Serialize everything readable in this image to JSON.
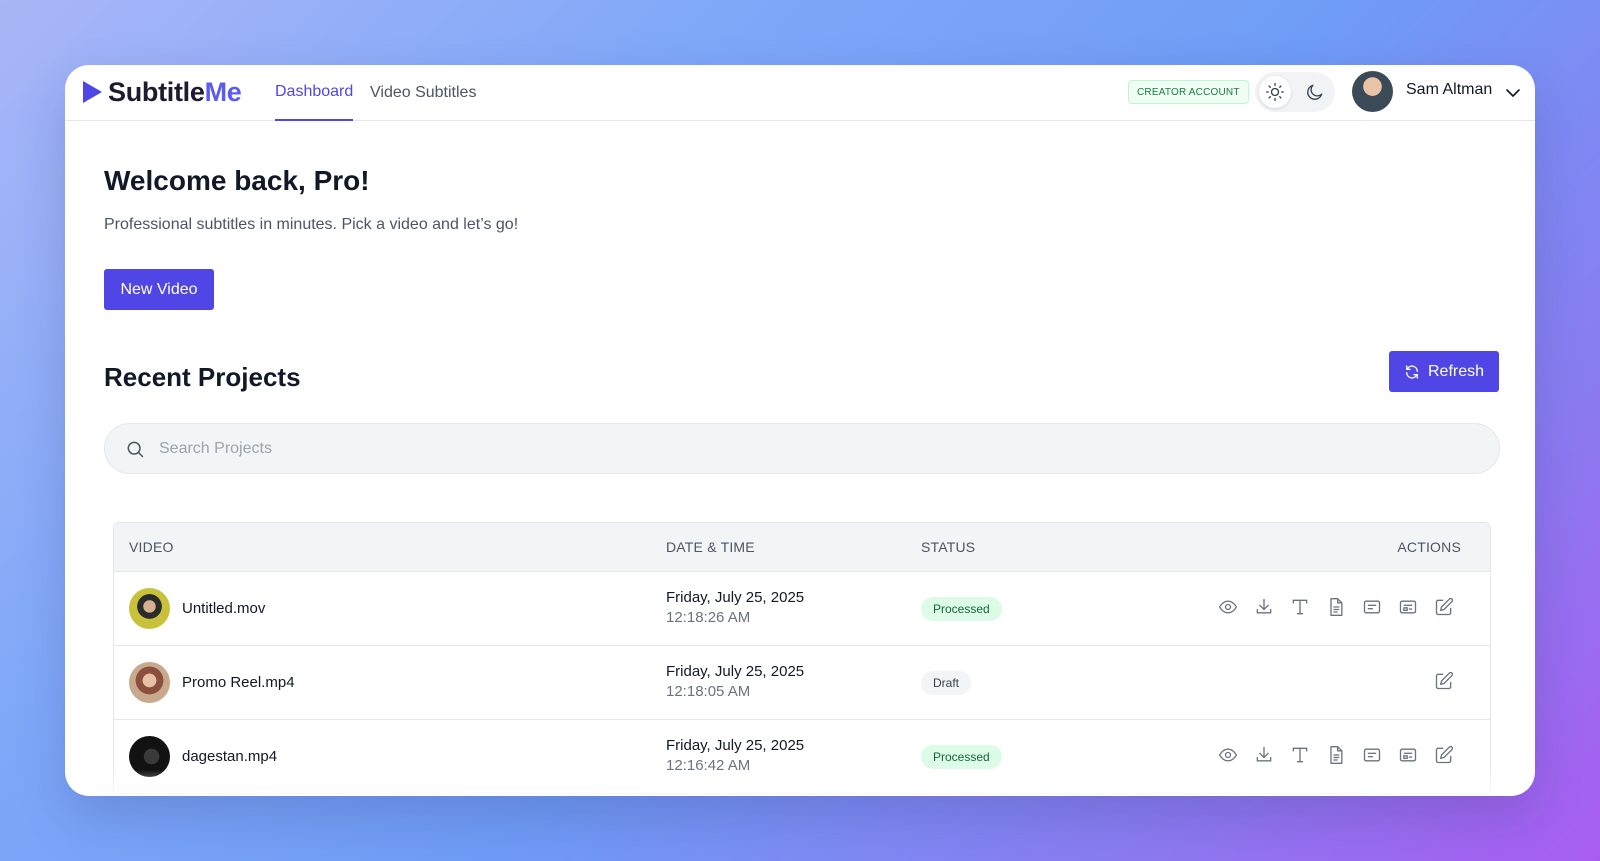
{
  "app": {
    "logo_main": "Subtitle",
    "logo_accent": "Me",
    "accent_color": "#4f46e5"
  },
  "nav": {
    "tabs": [
      {
        "label": "Dashboard",
        "active": true
      },
      {
        "label": "Video Subtitles",
        "active": false
      }
    ]
  },
  "header": {
    "account_badge": "CREATOR ACCOUNT",
    "theme_options": [
      "sun-icon",
      "moon-icon"
    ],
    "theme_selected": "light",
    "user_name": "Sam Altman"
  },
  "main": {
    "welcome": "Welcome back, Pro!",
    "subtitle": "Professional subtitles in minutes. Pick a video and let’s go!",
    "new_video_label": "New Video",
    "section_title": "Recent Projects",
    "refresh_label": "Refresh",
    "search_placeholder": "Search Projects"
  },
  "table": {
    "columns": [
      "VIDEO",
      "DATE & TIME",
      "STATUS",
      "ACTIONS"
    ],
    "rows": [
      {
        "name": "Untitled.mov",
        "date": "Friday, July 25, 2025",
        "time": "12:18:26 AM",
        "status": "Processed",
        "actions": [
          "eye-icon",
          "download-icon",
          "text-icon",
          "document-icon",
          "subtitle-icon",
          "caption-icon",
          "edit-icon"
        ]
      },
      {
        "name": "Promo Reel.mp4",
        "date": "Friday, July 25, 2025",
        "time": "12:18:05 AM",
        "status": "Draft",
        "actions": [
          "edit-icon"
        ]
      },
      {
        "name": "dagestan.mp4",
        "date": "Friday, July 25, 2025",
        "time": "12:16:42 AM",
        "status": "Processed",
        "actions": [
          "eye-icon",
          "download-icon",
          "text-icon",
          "document-icon",
          "subtitle-icon",
          "caption-icon",
          "edit-icon"
        ]
      }
    ]
  }
}
